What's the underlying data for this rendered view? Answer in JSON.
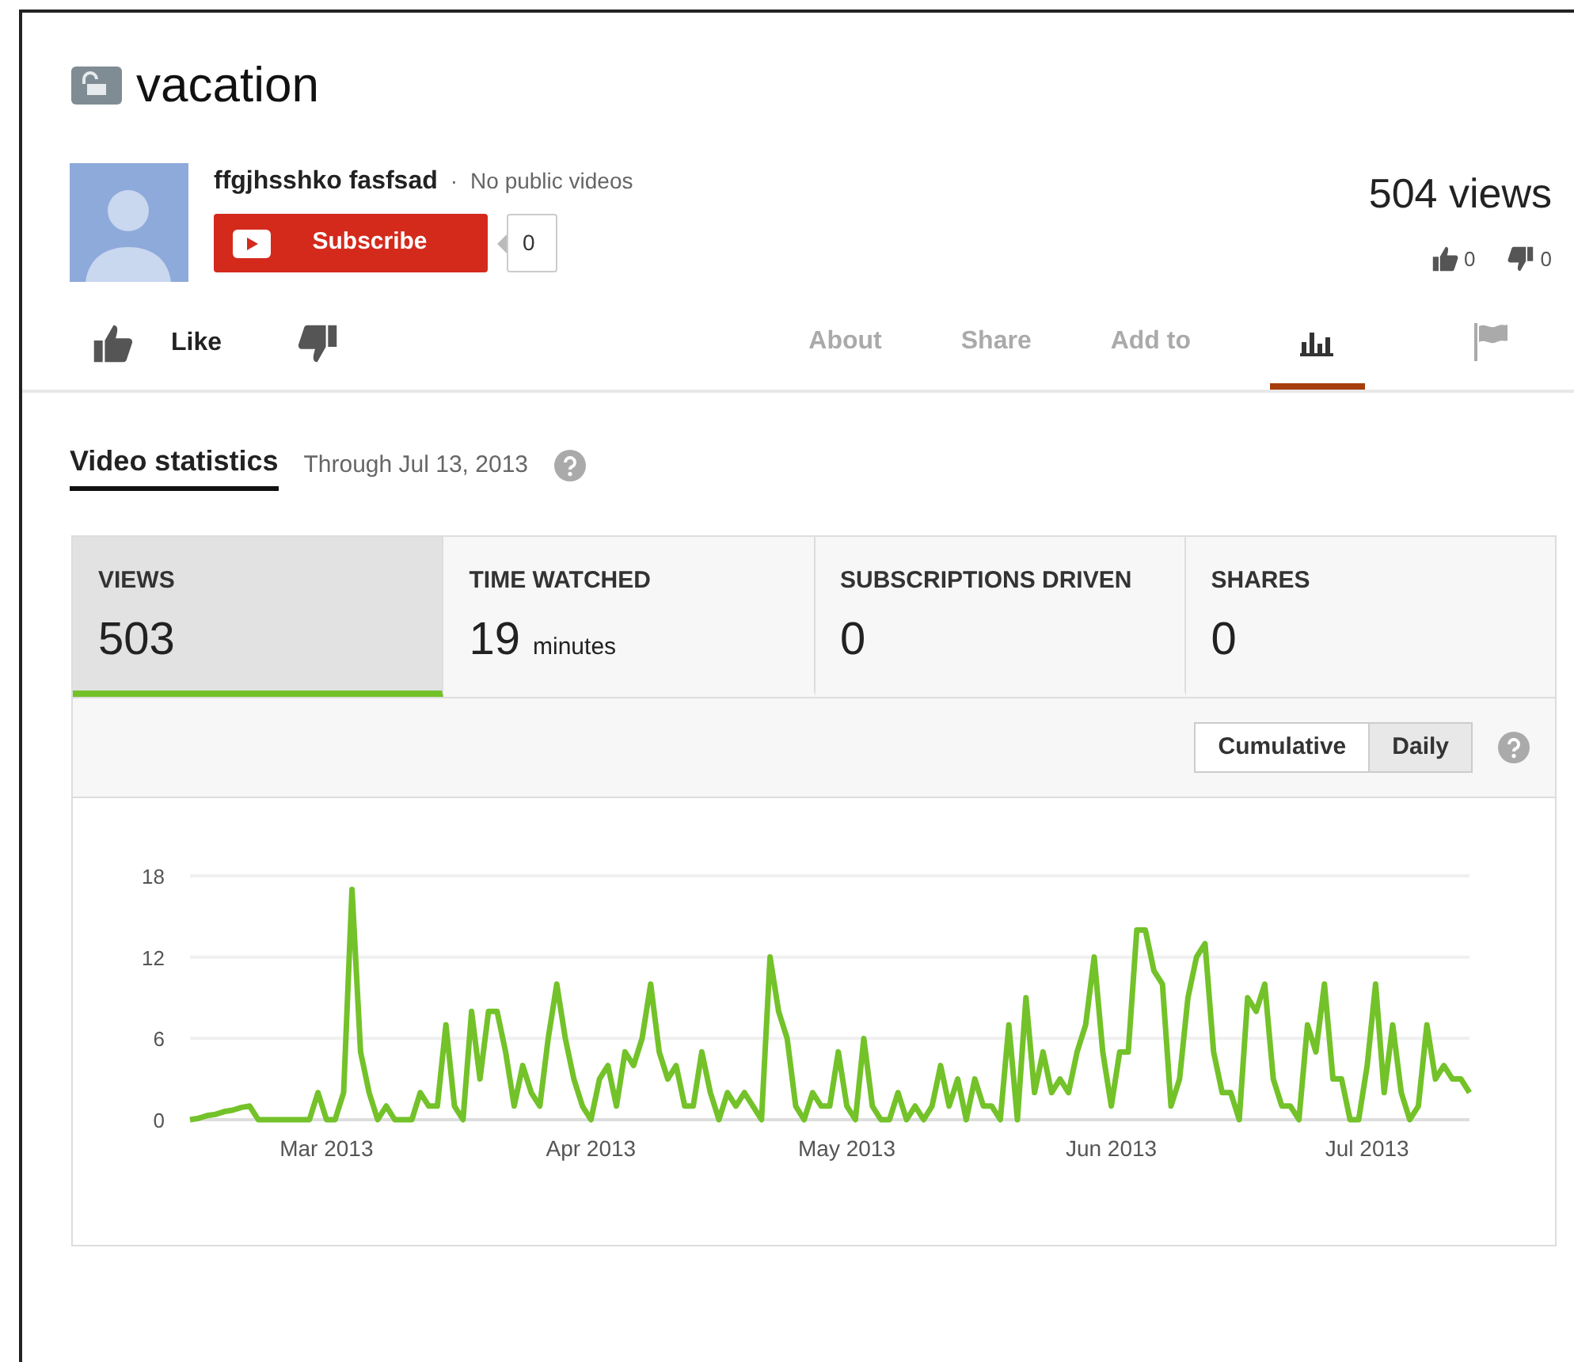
{
  "video": {
    "title": "vacation",
    "views": "504 views",
    "likes": "0",
    "dislikes": "0"
  },
  "channel": {
    "name": "ffgjhsshko fasfsad",
    "separator": "·",
    "note": "No public videos",
    "subscribe_label": "Subscribe",
    "subscriber_count": "0"
  },
  "actions": {
    "like_label": "Like"
  },
  "tabs": [
    {
      "kind": "text",
      "label": "About",
      "selected": false
    },
    {
      "kind": "text",
      "label": "Share",
      "selected": false
    },
    {
      "kind": "text",
      "label": "Add to",
      "selected": false
    },
    {
      "kind": "stats",
      "selected": true
    },
    {
      "kind": "flag",
      "selected": false
    }
  ],
  "statistics": {
    "heading": "Video statistics",
    "through": "Through Jul 13, 2013",
    "metrics": [
      {
        "label": "VIEWS",
        "value": "503",
        "selected": true
      },
      {
        "label": "TIME WATCHED",
        "value": "19",
        "unit": "minutes",
        "selected": false
      },
      {
        "label": "SUBSCRIPTIONS DRIVEN",
        "value": "0",
        "selected": false
      },
      {
        "label": "SHARES",
        "value": "0",
        "selected": false
      }
    ],
    "modes": [
      {
        "label": "Cumulative",
        "selected": false
      },
      {
        "label": "Daily",
        "selected": true
      }
    ],
    "chart_data": {
      "type": "line",
      "ylim": [
        0,
        18
      ],
      "yticks": [
        0,
        6,
        12,
        18
      ],
      "categories": [
        null,
        null,
        null,
        null,
        null,
        null,
        null,
        null,
        null,
        null,
        null,
        null,
        null,
        null,
        null,
        null,
        "Mar 2013",
        null,
        null,
        null,
        null,
        null,
        null,
        null,
        null,
        null,
        null,
        null,
        null,
        null,
        null,
        null,
        null,
        null,
        null,
        null,
        null,
        null,
        null,
        null,
        null,
        null,
        null,
        null,
        null,
        null,
        null,
        "Apr 2013",
        null,
        null,
        null,
        null,
        null,
        null,
        null,
        null,
        null,
        null,
        null,
        null,
        null,
        null,
        null,
        null,
        null,
        null,
        null,
        null,
        null,
        null,
        null,
        null,
        null,
        null,
        null,
        null,
        null,
        "May 2013",
        null,
        null,
        null,
        null,
        null,
        null,
        null,
        null,
        null,
        null,
        null,
        null,
        null,
        null,
        null,
        null,
        null,
        null,
        null,
        null,
        null,
        null,
        null,
        null,
        null,
        null,
        null,
        null,
        null,
        null,
        "Jun 2013",
        null,
        null,
        null,
        null,
        null,
        null,
        null,
        null,
        null,
        null,
        null,
        null,
        null,
        null,
        null,
        null,
        null,
        null,
        null,
        null,
        null,
        null,
        null,
        null,
        null,
        null,
        null,
        null,
        null,
        "Jul 2013",
        null,
        null,
        null,
        null,
        null,
        null,
        null,
        null,
        null,
        null,
        null,
        null
      ],
      "series": [
        {
          "color": "#73c229",
          "values": [
            0,
            0.1,
            0.3,
            0.4,
            0.6,
            0.7,
            0.9,
            1,
            0,
            0,
            0,
            0,
            0,
            0,
            0,
            2,
            0,
            0,
            2,
            17,
            5,
            2,
            0,
            1,
            0,
            0,
            0,
            2,
            1,
            1,
            7,
            1,
            0,
            8,
            3,
            8,
            8,
            5,
            1,
            4,
            2,
            1,
            6,
            10,
            6,
            3,
            1,
            0,
            3,
            4,
            1,
            5,
            4,
            6,
            10,
            5,
            3,
            4,
            1,
            1,
            5,
            2,
            0,
            2,
            1,
            2,
            1,
            0,
            12,
            8,
            6,
            1,
            0,
            2,
            1,
            1,
            5,
            1,
            0,
            6,
            1,
            0,
            0,
            2,
            0,
            1,
            0,
            1,
            4,
            1,
            3,
            0,
            3,
            1,
            1,
            0,
            7,
            0,
            9,
            2,
            5,
            2,
            3,
            2,
            5,
            7,
            12,
            5,
            1,
            5,
            5,
            14,
            14,
            11,
            10,
            1,
            3,
            9,
            12,
            13,
            5,
            2,
            2,
            0,
            9,
            8,
            10,
            3,
            1,
            1,
            0,
            7,
            5,
            10,
            3,
            3,
            0,
            0,
            4,
            10,
            2,
            7,
            2,
            0,
            1,
            7,
            3,
            4,
            3,
            3,
            2
          ]
        }
      ]
    }
  }
}
